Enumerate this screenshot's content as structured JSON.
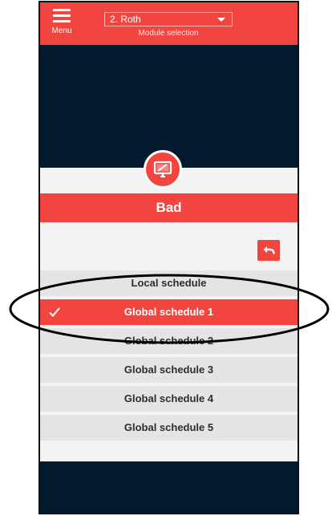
{
  "header": {
    "menu_label": "Menu",
    "module_value": "2. Roth",
    "module_caption": "Module selection"
  },
  "room": {
    "title": "Bad",
    "icon": "monitor-icon"
  },
  "schedules": [
    {
      "label": "Local schedule",
      "selected": false
    },
    {
      "label": "Global schedule 1",
      "selected": true
    },
    {
      "label": "Global schedule 2",
      "selected": false
    },
    {
      "label": "Global schedule 3",
      "selected": false
    },
    {
      "label": "Global schedule 4",
      "selected": false
    },
    {
      "label": "Global schedule 5",
      "selected": false
    }
  ],
  "colors": {
    "accent": "#f2453f",
    "dark_bg": "#031a2e",
    "row_bg": "#e4e4e4"
  }
}
